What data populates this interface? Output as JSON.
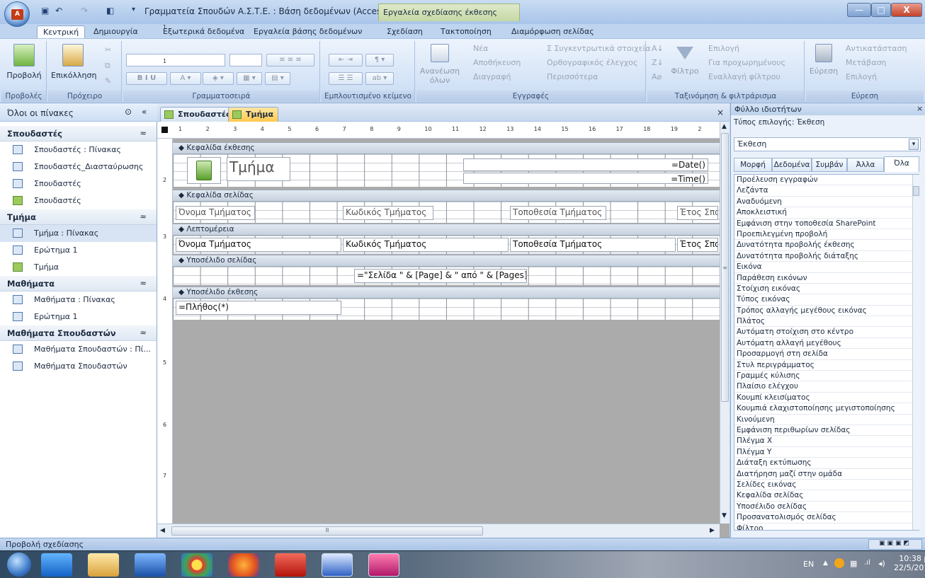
{
  "window": {
    "title": "Γραμματεία Σπουδών Α.Σ.Τ.Ε. : Βάση δεδομένων (Access ...",
    "context_tab": "Εργαλεία σχεδίασης έκθεσης",
    "controls": {
      "minimize": "—",
      "maximize": "□",
      "close": "X"
    },
    "help": "?"
  },
  "ribbon_tabs": [
    "Κεντρική",
    "Δημιουργία",
    "Εξωτερικά δεδομένα",
    "Εργαλεία βάσης δεδομένων",
    "Σχεδίαση",
    "Τακτοποίηση",
    "Διαμόρφωση σελίδας"
  ],
  "ribbon": {
    "groups": [
      "Προβολές",
      "Πρόχειρο",
      "Γραμματοσειρά",
      "Εμπλουτισμένο κείμενο",
      "Εγγραφές",
      "Ταξινόμηση & φιλτράρισμα",
      "Εύρεση"
    ],
    "view_button": "Προβολή",
    "paste_button": "Επικόλληση",
    "refresh_button": "Ανανέωση όλων",
    "records": [
      "Νέα",
      "Αποθήκευση",
      "Διαγραφή",
      "Σ Συγκεντρωτικά στοιχεία",
      "Ορθογραφικός έλεγχος",
      "Περισσότερα"
    ],
    "filter_button": "Φίλτρο",
    "filter_items": [
      "Επιλογή",
      "Για προχωρημένους",
      "Εναλλαγή φίλτρου"
    ],
    "find_button": "Εύρεση",
    "find_items": [
      "Αντικατάσταση",
      "Μετάβαση",
      "Επιλογή"
    ]
  },
  "nav": {
    "header": "Όλοι οι πίνακες",
    "groups": [
      {
        "title": "Σπουδαστές",
        "items": [
          "Σπουδαστές : Πίνακας",
          "Σπουδαστές_Διασταύρωσης",
          "Σπουδαστές",
          "Σπουδαστές"
        ]
      },
      {
        "title": "Τμήμα",
        "items": [
          "Τμήμα : Πίνακας",
          "Ερώτημα 1",
          "Τμήμα"
        ]
      },
      {
        "title": "Μαθήματα",
        "items": [
          "Μαθήματα : Πίνακας",
          "Ερώτημα 1"
        ]
      },
      {
        "title": "Μαθήματα Σπουδαστών",
        "items": [
          "Μαθήματα Σπουδαστών : Πί...",
          "Μαθήματα Σπουδαστών"
        ]
      }
    ]
  },
  "doc_tabs": [
    "Σπουδαστές",
    "Τμήμα"
  ],
  "sections": {
    "report_header": "Κεφαλίδα έκθεσης",
    "page_header": "Κεφαλίδα σελίδας",
    "detail": "Λεπτομέρεια",
    "page_footer": "Υποσέλιδο σελίδας",
    "report_footer": "Υποσέλιδο έκθεσης"
  },
  "controls": {
    "report_title": "Τμήμα",
    "date_expr": "=Date()",
    "time_expr": "=Time()",
    "labels": [
      "Όνομα Τμήματος",
      "Κωδικός Τμήματος",
      "Τοποθεσία Τμήματος",
      "Έτος Σπο"
    ],
    "fields": [
      "Όνομα Τμήματος",
      "Κωδικός Τμήματος",
      "Τοποθεσία Τμήματος",
      "Έτος Σπο"
    ],
    "page_expr": "=\"Σελίδα \" & [Page] & \" από \" & [Pages]",
    "count_expr": "=Πλήθος(*)"
  },
  "ruler_marks": [
    "1",
    "2",
    "3",
    "4",
    "5",
    "6",
    "7",
    "8",
    "9",
    "10",
    "11",
    "12",
    "13",
    "14",
    "15",
    "16",
    "17",
    "18",
    "19",
    "2"
  ],
  "vruler_marks": [
    "1",
    "1",
    "2",
    "3",
    "4",
    "5",
    "6",
    "7",
    "8"
  ],
  "props": {
    "header": "Φύλλο ιδιοτήτων",
    "selection_type": "Τύπος επιλογής: Έκθεση",
    "selected": "Έκθεση",
    "tabs": [
      "Μορφή",
      "Δεδομένα",
      "Συμβάν",
      "Άλλα",
      "Όλα"
    ],
    "rows": [
      "Προέλευση εγγραφών",
      "Λεζάντα",
      "Αναδυόμενη",
      "Αποκλειστική",
      "Εμφάνιση στην τοποθεσία SharePoint",
      "Προεπιλεγμένη προβολή",
      "Δυνατότητα προβολής έκθεσης",
      "Δυνατότητα προβολής διάταξης",
      "Εικόνα",
      "Παράθεση εικόνων",
      "Στοίχιση εικόνας",
      "Τύπος εικόνας",
      "Τρόπος αλλαγής μεγέθους εικόνας",
      "Πλάτος",
      "Αυτόματη στοίχιση στο κέντρο",
      "Αυτόματη αλλαγή μεγέθους",
      "Προσαρμογή στη σελίδα",
      "Στυλ περιγράμματος",
      "Γραμμές κύλισης",
      "Πλαίσιο ελέγχου",
      "Κουμπί κλεισίματος",
      "Κουμπιά ελαχιστοποίησης μεγιστοποίησης",
      "Κινούμενη",
      "Εμφάνιση περιθωρίων σελίδας",
      "Πλέγμα Χ",
      "Πλέγμα Υ",
      "Διάταξη εκτύπωσης",
      "Διατήρηση μαζί στην ομάδα",
      "Σελίδες εικόνας",
      "Κεφαλίδα σελίδας",
      "Υποσέλιδο σελίδας",
      "Προσανατολισμός σελίδας",
      "Φίλτρο"
    ]
  },
  "status": {
    "text": "Προβολή σχεδίασης"
  },
  "tray": {
    "lang": "EN",
    "time": "10:38 μμ",
    "date": "22/5/2014"
  }
}
